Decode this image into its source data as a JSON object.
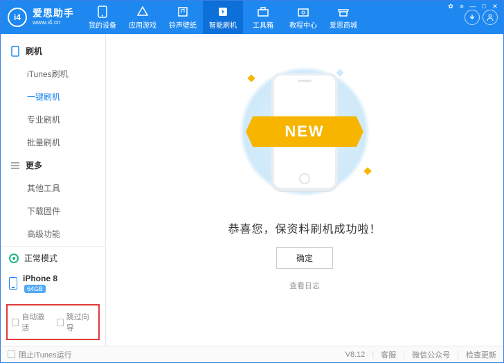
{
  "brand": {
    "title": "爱思助手",
    "sub": "www.i4.cn",
    "logo_text": "i4"
  },
  "topnav": {
    "items": [
      {
        "label": "我的设备",
        "icon": "phone"
      },
      {
        "label": "应用游戏",
        "icon": "apps"
      },
      {
        "label": "铃声壁纸",
        "icon": "music"
      },
      {
        "label": "智能刷机",
        "icon": "flash",
        "active": true
      },
      {
        "label": "工具箱",
        "icon": "toolbox"
      },
      {
        "label": "教程中心",
        "icon": "book"
      },
      {
        "label": "爱思商城",
        "icon": "store"
      }
    ]
  },
  "sidebar": {
    "sections": [
      {
        "title": "刷机",
        "items": [
          "iTunes刷机",
          "一键刷机",
          "专业刷机",
          "批量刷机"
        ],
        "active_index": 1
      },
      {
        "title": "更多",
        "items": [
          "其他工具",
          "下载固件",
          "高级功能"
        ]
      }
    ],
    "mode": "正常模式",
    "device": {
      "name": "iPhone 8",
      "storage": "64GB"
    },
    "options": {
      "auto_activate": "自动激活",
      "skip_guide": "跳过向导"
    }
  },
  "main": {
    "ribbon_text": "NEW",
    "success_msg": "恭喜您，保资料刷机成功啦！",
    "ok_label": "确定",
    "log_label": "查看日志"
  },
  "statusbar": {
    "block_itunes": "阻止iTunes运行",
    "version": "V8.12",
    "support": "客服",
    "wechat": "微信公众号",
    "update": "检查更新"
  }
}
